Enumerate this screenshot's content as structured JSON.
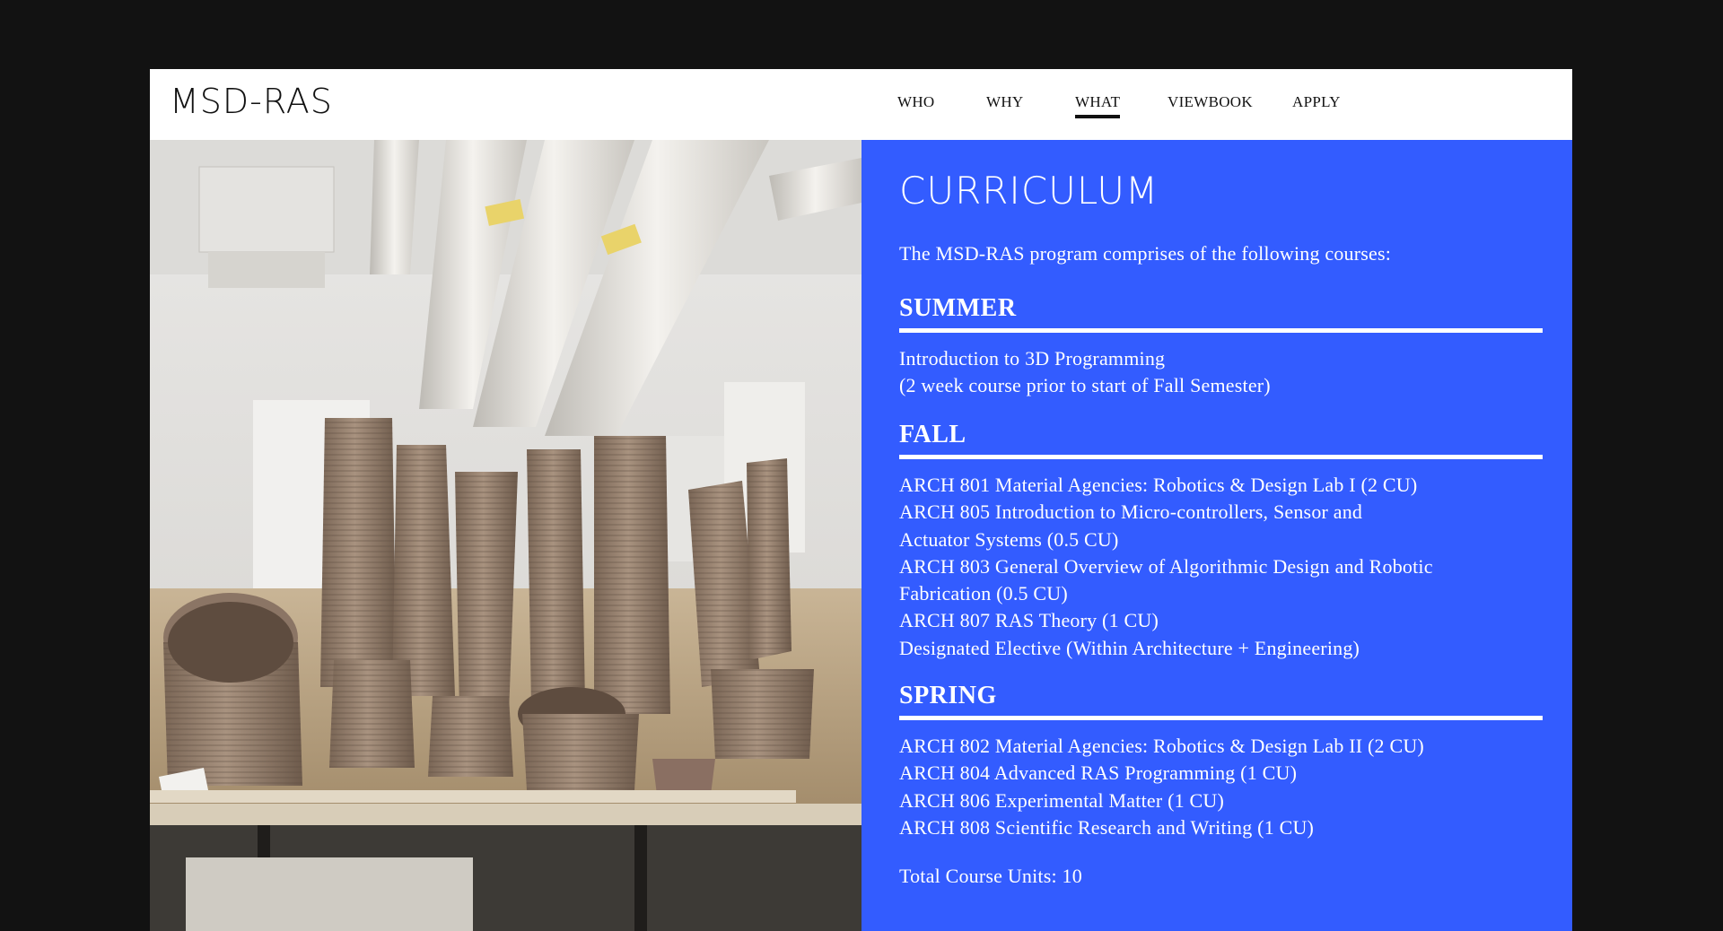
{
  "header": {
    "logo": "MSD-RAS",
    "nav": [
      {
        "label": "WHO",
        "active": false
      },
      {
        "label": "WHY",
        "active": false
      },
      {
        "label": "WHAT",
        "active": true
      },
      {
        "label": "VIEWBOOK",
        "active": false
      },
      {
        "label": "APPLY",
        "active": false
      }
    ]
  },
  "hero_image": {
    "description_icon": "3d-printed-clay-towers-photo"
  },
  "curriculum": {
    "title": "CURRICULUM",
    "intro": "The MSD-RAS program comprises of the following courses:",
    "sections": [
      {
        "heading": "SUMMER",
        "courses": [
          "Introduction to 3D Programming",
          "(2 week course prior to start of Fall Semester)"
        ]
      },
      {
        "heading": "FALL",
        "courses": [
          "ARCH 801 Material Agencies: Robotics & Design Lab I (2 CU)",
          "ARCH 805 Introduction to Micro-controllers, Sensor and",
          "Actuator Systems (0.5 CU)",
          "ARCH 803 General Overview of Algorithmic Design and Robotic",
          "Fabrication (0.5 CU)",
          "ARCH 807 RAS Theory (1 CU)",
          "Designated Elective (Within Architecture + Engineering)"
        ]
      },
      {
        "heading": "SPRING",
        "courses": [
          "ARCH 802 Material Agencies: Robotics & Design Lab II (2 CU)",
          "ARCH 804 Advanced RAS Programming (1 CU)",
          "ARCH 806 Experimental Matter (1 CU)",
          "ARCH 808 Scientific Research and Writing (1 CU)"
        ]
      }
    ],
    "total": "Total Course Units: 10"
  },
  "colors": {
    "page_background": "#121212",
    "panel_blue": "#335cff",
    "text_dark": "#111111",
    "text_light": "#ffffff"
  }
}
